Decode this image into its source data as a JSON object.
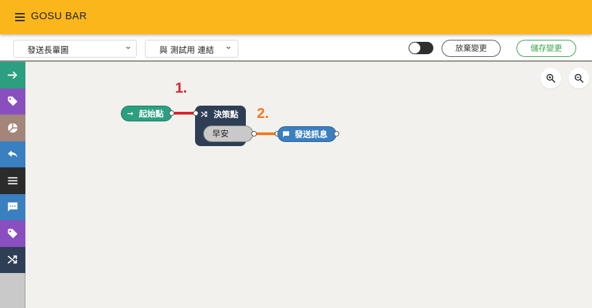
{
  "header": {
    "title": "GOSU BAR",
    "menu_icon": "hamburger-menu-icon",
    "color": "#fbb61b"
  },
  "toolbar": {
    "flow_select": {
      "value": "發送長輩圖",
      "options_visible": [
        "發送長輩圖"
      ]
    },
    "link_select": {
      "value": "與 測試用 連結"
    },
    "discard_label": "放棄變更",
    "save_label": "儲存變更",
    "save_color": "#3aa34a"
  },
  "sidebar": {
    "items": [
      {
        "icon": "arrow-right-icon",
        "color": "#2c9f80"
      },
      {
        "icon": "tag-icon",
        "color": "#8a4fbf"
      },
      {
        "icon": "pie-chart-icon",
        "color": "#a3857a"
      },
      {
        "icon": "reply-icon",
        "color": "#3a7fc0"
      },
      {
        "icon": "menu-lines-icon",
        "color": "#2b2b2b"
      },
      {
        "icon": "message-dots-icon",
        "color": "#3a7fc0"
      },
      {
        "icon": "tag-icon",
        "color": "#8a4fbf"
      },
      {
        "icon": "shuffle-icon",
        "color": "#2e3e55"
      }
    ]
  },
  "canvas": {
    "zoom_in_icon": "zoom-in-icon",
    "zoom_out_icon": "zoom-out-icon",
    "annotations": [
      {
        "text": "1.",
        "color": "#d9232d"
      },
      {
        "text": "2.",
        "color": "#f07b1f"
      }
    ],
    "nodes": {
      "start": {
        "label": "起始點",
        "icon": "arrow-right-icon",
        "color": "#2c9f80"
      },
      "decision": {
        "label": "決策點",
        "icon": "shuffle-icon",
        "color": "#2e3e55",
        "option": "早安"
      },
      "send": {
        "label": "發送訊息",
        "icon": "chat-bubble-icon",
        "color": "#3a7fc0"
      }
    },
    "links": [
      {
        "from": "start",
        "to": "decision",
        "color": "#d9232d"
      },
      {
        "from": "decision.option",
        "to": "send",
        "color": "#f07b1f"
      }
    ]
  }
}
